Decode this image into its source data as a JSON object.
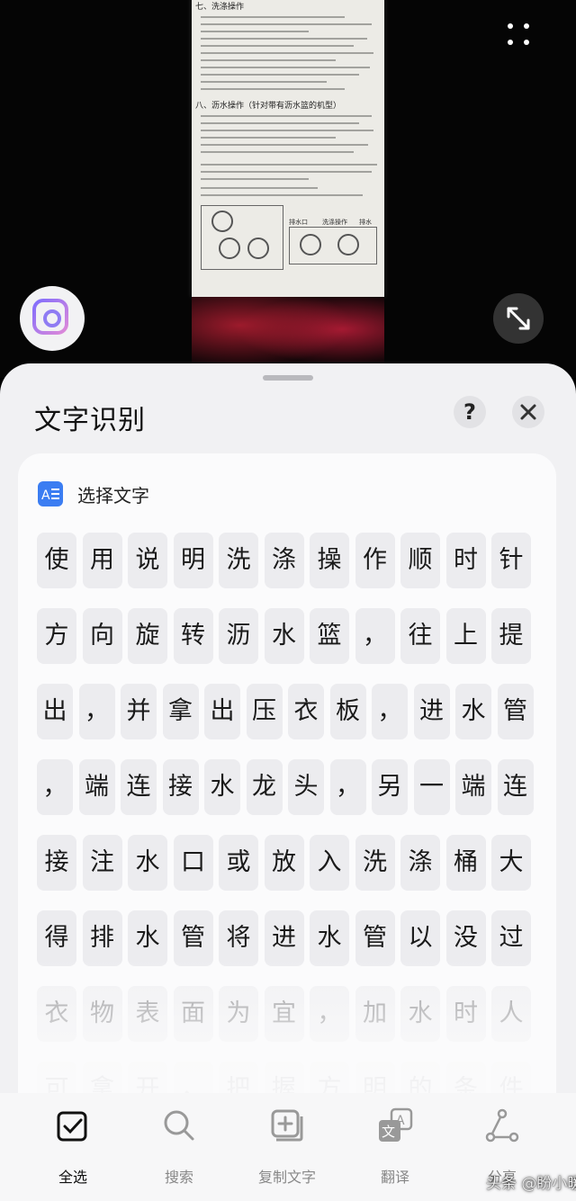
{
  "preview": {
    "document_headings": [
      "七、洗涤操作",
      "八、沥水操作（针对带有沥水篮的机型）"
    ],
    "panel_labels": [
      "排水口",
      "洗涤操作",
      "排水"
    ]
  },
  "sheet": {
    "title": "文字识别",
    "help_label": "?",
    "select_text_label": "选择文字"
  },
  "recognized_rows": [
    [
      "使",
      "用",
      "说",
      "明",
      "洗",
      "涤",
      "操",
      "作",
      "顺",
      "时",
      "针"
    ],
    [
      "方",
      "向",
      "旋",
      "转",
      "沥",
      "水",
      "篮",
      "，",
      "往",
      "上",
      "提"
    ],
    [
      "出",
      "，",
      "并",
      "拿",
      "出",
      "压",
      "衣",
      "板",
      "，",
      "进",
      "水",
      "管"
    ],
    [
      "，",
      "端",
      "连",
      "接",
      "水",
      "龙",
      "头",
      "，",
      "另",
      "一",
      "端",
      "连"
    ],
    [
      "接",
      "注",
      "水",
      "口",
      "或",
      "放",
      "入",
      "洗",
      "涤",
      "桶",
      "大"
    ],
    [
      "得",
      "排",
      "水",
      "管",
      "将",
      "进",
      "水",
      "管",
      "以",
      "没",
      "过"
    ],
    [
      "衣",
      "物",
      "表",
      "面",
      "为",
      "宜",
      "，",
      "加",
      "水",
      "时",
      "人"
    ],
    [
      "可",
      "拿",
      "开",
      "，",
      "把",
      "握",
      "方",
      "明",
      "的",
      "条",
      "件"
    ]
  ],
  "toolbar": [
    {
      "label": "全选",
      "icon": "select-all-icon",
      "active": true
    },
    {
      "label": "搜索",
      "icon": "search-icon",
      "active": false
    },
    {
      "label": "复制文字",
      "icon": "copy-text-icon",
      "active": false
    },
    {
      "label": "翻译",
      "icon": "translate-icon",
      "active": false
    },
    {
      "label": "分享",
      "icon": "share-icon",
      "active": false
    }
  ],
  "watermark": "头条 @盼小暖",
  "colors": {
    "accent": "#3b7df2",
    "sheet_bg": "#f1f1f3",
    "cell_bg": "#ececef"
  }
}
